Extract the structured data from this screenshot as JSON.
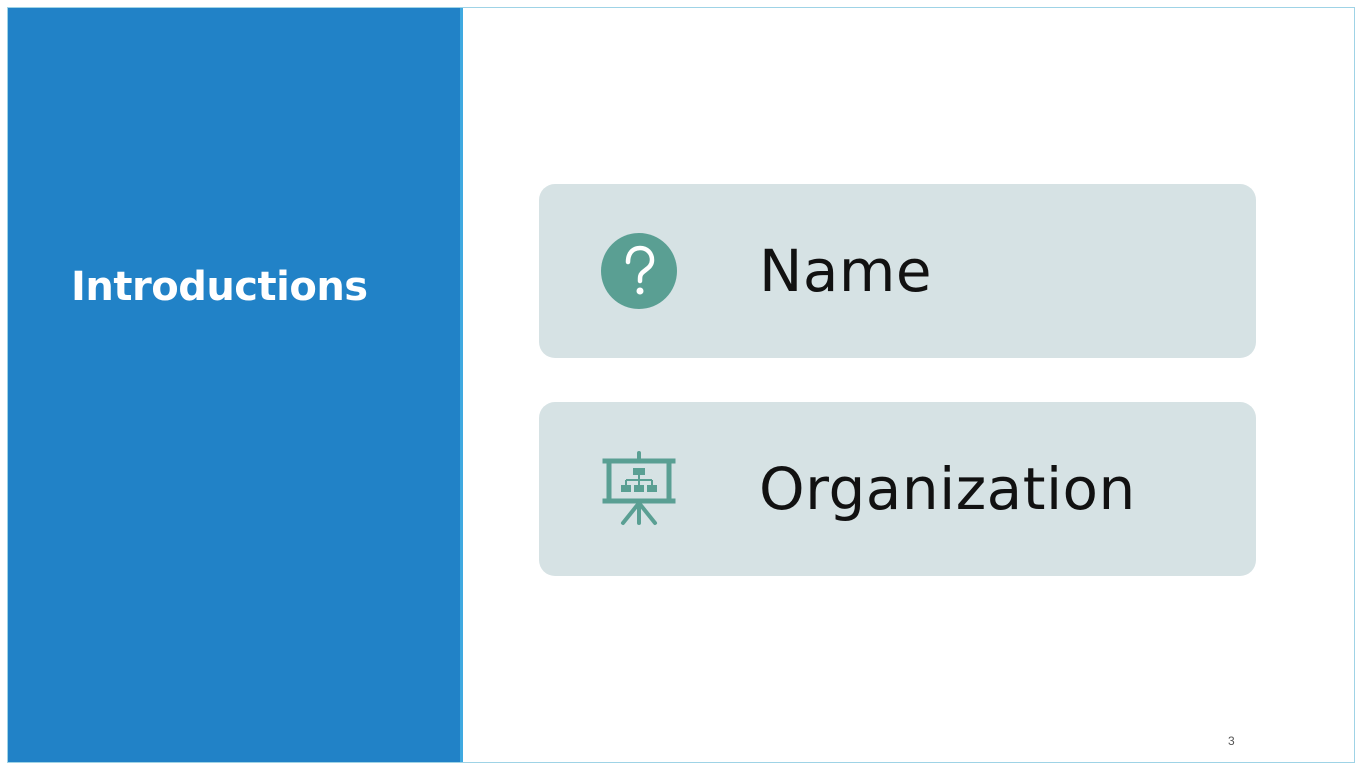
{
  "slide": {
    "title": "Introductions",
    "page_number": "3",
    "items": [
      {
        "label": "Name",
        "icon": "question-circle-icon"
      },
      {
        "label": "Organization",
        "icon": "presentation-org-chart-icon"
      }
    ]
  },
  "colors": {
    "left_panel": "#2182c7",
    "accent": "#3fa9e0",
    "card_bg": "#d6e2e4",
    "icon": "#5a9f93"
  }
}
